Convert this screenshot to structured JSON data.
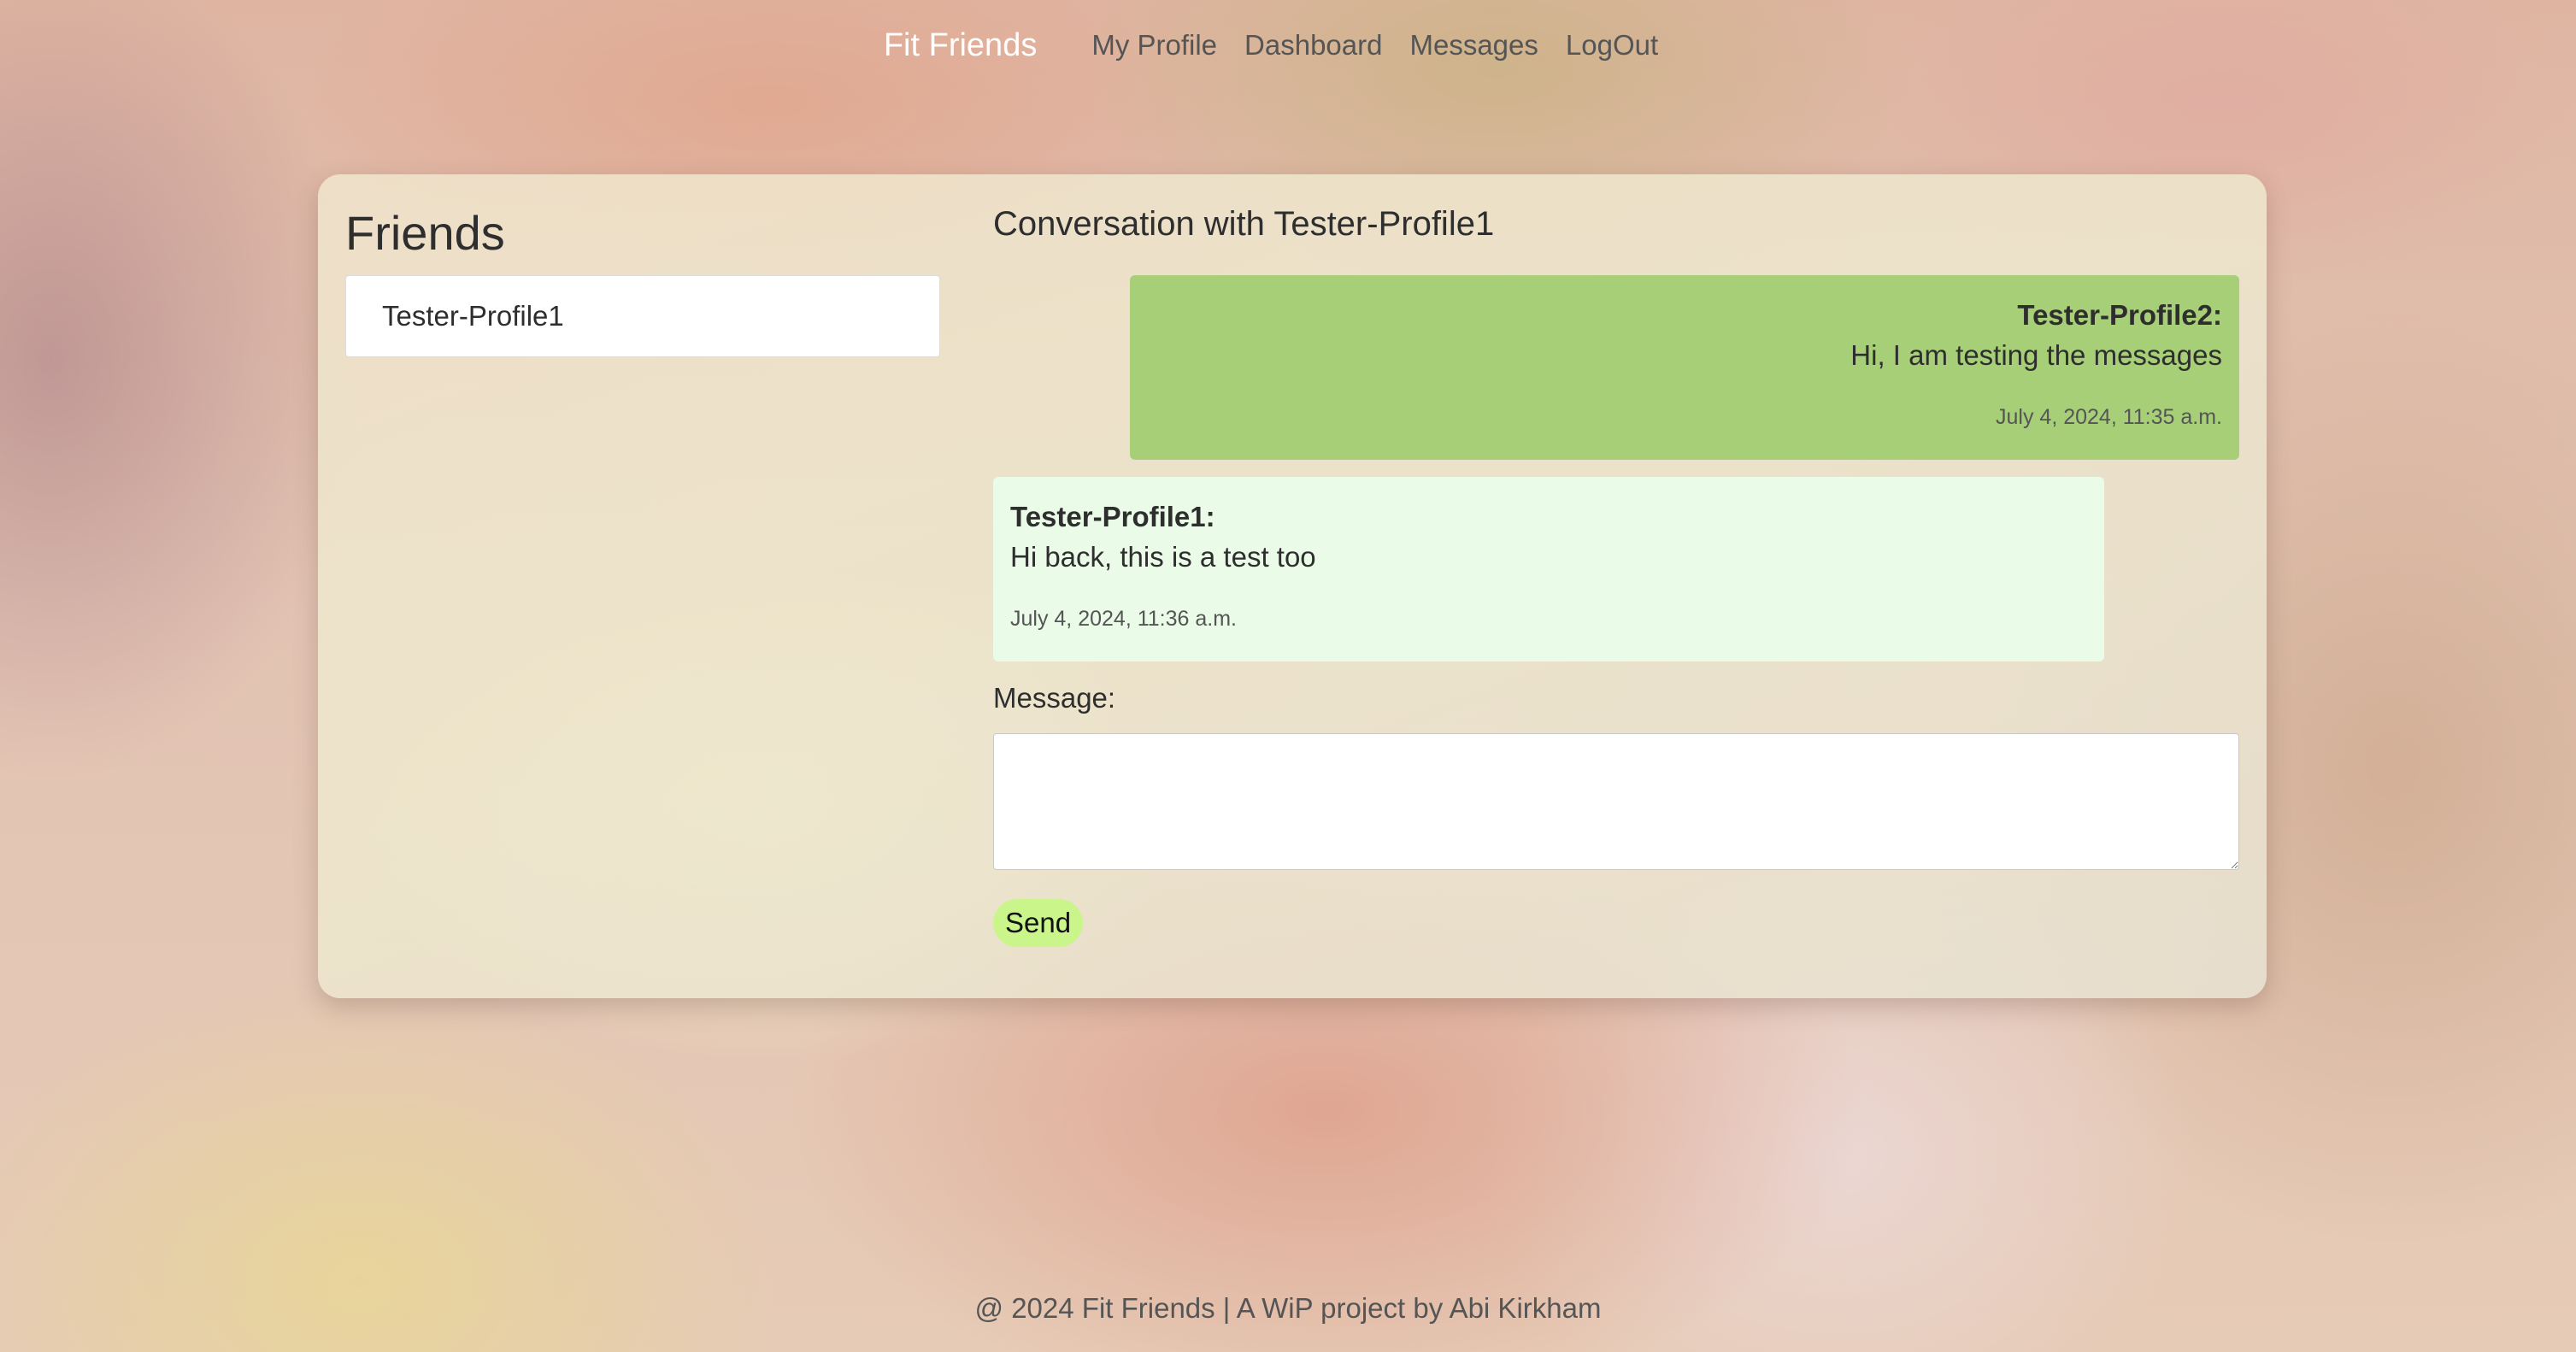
{
  "nav": {
    "brand": "Fit Friends",
    "links": [
      "My Profile",
      "Dashboard",
      "Messages",
      "LogOut"
    ]
  },
  "friends": {
    "title": "Friends",
    "items": [
      "Tester-Profile1"
    ]
  },
  "conversation": {
    "title": "Conversation with Tester-Profile1",
    "messages": [
      {
        "sender": "Tester-Profile2:",
        "text": "Hi, I am testing the messages",
        "time": "July 4, 2024, 11:35 a.m.",
        "color": "#a7cf78"
      },
      {
        "sender": "Tester-Profile1:",
        "text": "Hi back, this is a test too",
        "time": "July 4, 2024, 11:36 a.m.",
        "color": "#eafbe8"
      }
    ]
  },
  "form": {
    "label": "Message:",
    "value": "",
    "send_label": "Send",
    "send_color": "#c9f58b"
  },
  "footer": {
    "text": "@ 2024 Fit Friends | A WiP project by Abi Kirkham"
  }
}
